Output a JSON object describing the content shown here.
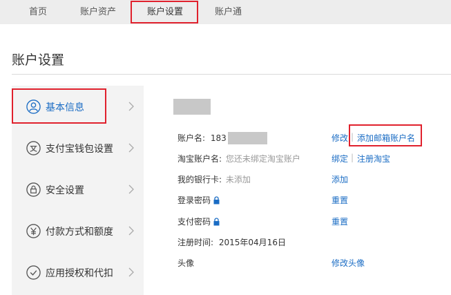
{
  "nav": {
    "tabs": [
      {
        "label": "首页"
      },
      {
        "label": "账户资产"
      },
      {
        "label": "账户设置"
      },
      {
        "label": "账户通"
      }
    ]
  },
  "page": {
    "title": "账户设置"
  },
  "sidebar": {
    "items": [
      {
        "label": "基本信息",
        "icon": "user-icon"
      },
      {
        "label": "支付宝钱包设置",
        "icon": "wallet-icon"
      },
      {
        "label": "安全设置",
        "icon": "lock-icon"
      },
      {
        "label": "付款方式和额度",
        "icon": "yuan-icon"
      },
      {
        "label": "应用授权和代扣",
        "icon": "check-icon"
      }
    ]
  },
  "info": {
    "account_name_label": "账户名:",
    "account_name_value": "183",
    "taobao_label": "淘宝账户名:",
    "taobao_value": "您还未绑定淘宝账户",
    "bankcard_label": "我的银行卡:",
    "bankcard_value": "未添加",
    "login_pwd_label": "登录密码",
    "pay_pwd_label": "支付密码",
    "reg_label": "注册时间:",
    "reg_value": "2015年04月16日",
    "avatar_label": "头像"
  },
  "actions": {
    "modify": "修改",
    "add_email": "添加邮箱账户名",
    "bind": "绑定",
    "register_taobao": "注册淘宝",
    "add": "添加",
    "reset_login": "重置",
    "reset_pay": "重置",
    "modify_avatar": "修改头像",
    "separator": "|"
  },
  "colors": {
    "link": "#1a6cc4",
    "highlight": "#e0202c",
    "nav_bg": "#ededed",
    "sidebar_bg": "#f3f3f3"
  }
}
